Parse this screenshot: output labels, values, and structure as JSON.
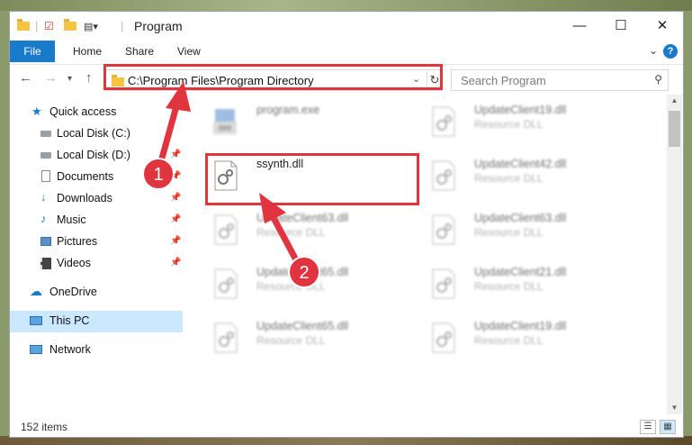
{
  "window": {
    "title": "Program"
  },
  "ribbon": {
    "tabs": [
      "File",
      "Home",
      "Share",
      "View"
    ],
    "help": "?"
  },
  "address": {
    "path": "C:\\Program Files\\Program Directory"
  },
  "search": {
    "placeholder": "Search Program"
  },
  "sidebar": {
    "quick_access": "Quick access",
    "items": [
      {
        "label": "Local Disk (C:)",
        "icon": "drive-icon"
      },
      {
        "label": "Local Disk (D:)",
        "icon": "drive-icon"
      },
      {
        "label": "Documents",
        "icon": "documents-icon"
      },
      {
        "label": "Downloads",
        "icon": "downloads-icon"
      },
      {
        "label": "Music",
        "icon": "music-icon"
      },
      {
        "label": "Pictures",
        "icon": "pictures-icon"
      },
      {
        "label": "Videos",
        "icon": "videos-icon"
      }
    ],
    "onedrive": "OneDrive",
    "thispc": "This PC",
    "network": "Network"
  },
  "files": [
    {
      "name": "program.exe",
      "type": ""
    },
    {
      "name": "UpdateClient19.dll",
      "type": "Resource DLL"
    },
    {
      "name": "ssynth.dll",
      "type": ""
    },
    {
      "name": "UpdateClient42.dll",
      "type": "Resource DLL"
    },
    {
      "name": "UpdateClient63.dll",
      "type": "Resource DLL"
    },
    {
      "name": "UpdateClient63.dll",
      "type": "Resource DLL"
    },
    {
      "name": "UpdateClient65.dll",
      "type": "Resource DLL"
    },
    {
      "name": "UpdateClient21.dll",
      "type": "Resource DLL"
    },
    {
      "name": "UpdateClient65.dll",
      "type": "Resource DLL"
    },
    {
      "name": "UpdateClient19.dll",
      "type": "Resource DLL"
    }
  ],
  "status": {
    "count": "152 items"
  },
  "annotations": {
    "step1": "1",
    "step2": "2",
    "color": "#e0343f"
  },
  "colors": {
    "accent": "#1979ca",
    "selected": "#cce8ff"
  }
}
